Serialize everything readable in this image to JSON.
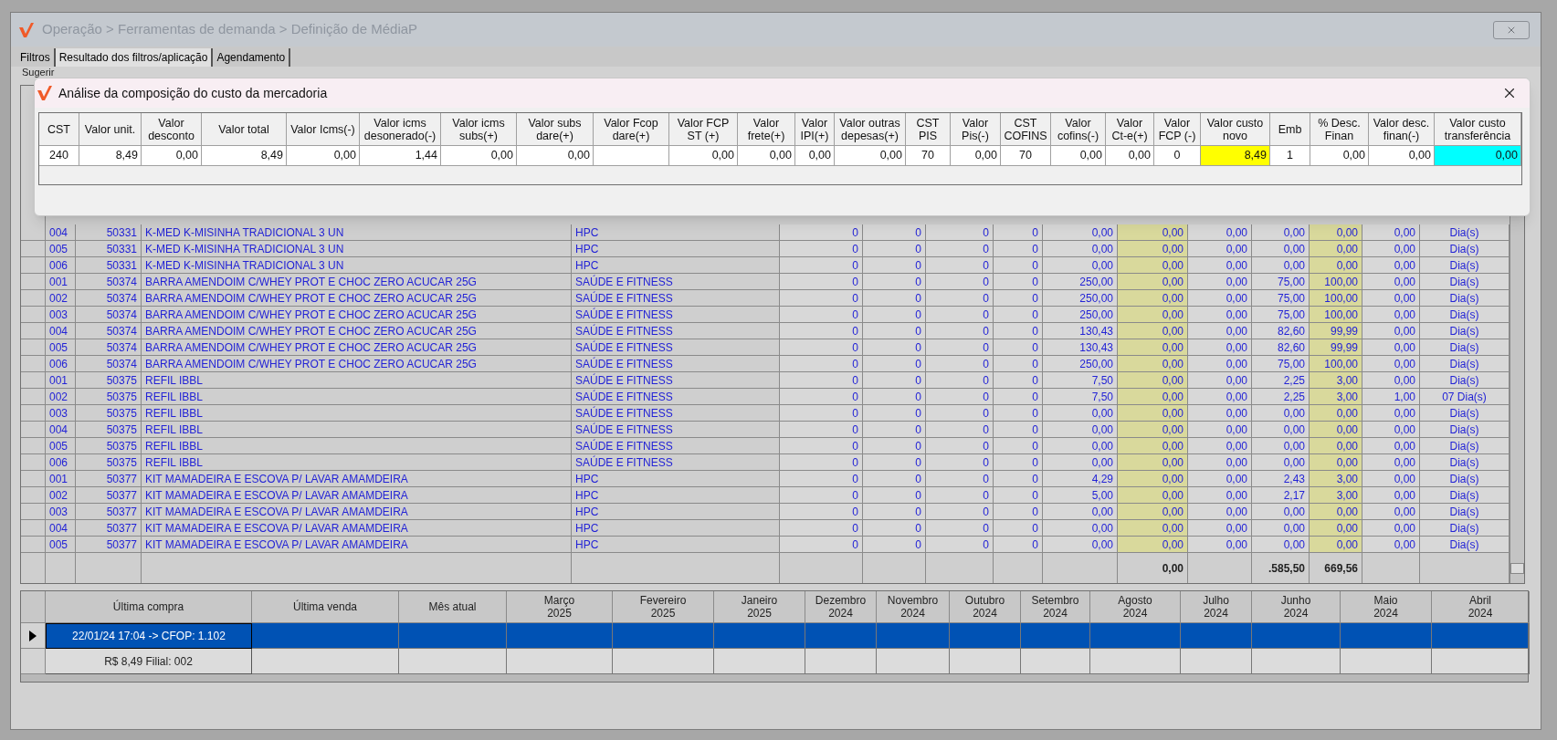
{
  "window": {
    "title": "Operação > Ferramentas de demanda > Definição de MédiaP"
  },
  "tabs": [
    {
      "label": "Filtros",
      "selected": false
    },
    {
      "label": "Resultado dos filtros/aplicação",
      "selected": true
    },
    {
      "label": "Agendamento",
      "selected": false
    }
  ],
  "group_label": "Sugerir",
  "grid": {
    "columns": [
      {
        "highlight": false
      },
      {
        "highlight": false
      },
      {
        "highlight": false
      },
      {
        "highlight": false
      },
      {
        "highlight": false
      },
      {
        "highlight": true
      },
      {
        "highlight": false
      },
      {
        "highlight": false
      },
      {
        "highlight": true
      },
      {
        "highlight": false
      },
      {
        "highlight": false
      }
    ],
    "rows": [
      {
        "branch": "004",
        "code": "50331",
        "description": "K-MED K-MISINHA TRADICIONAL 3 UN",
        "category": "HPC",
        "values": [
          "0",
          "0",
          "0",
          "0",
          "0,00",
          "0,00",
          "0,00",
          "0,00",
          "0,00",
          "0,00",
          "Dia(s)"
        ]
      },
      {
        "branch": "005",
        "code": "50331",
        "description": "K-MED K-MISINHA TRADICIONAL 3 UN",
        "category": "HPC",
        "values": [
          "0",
          "0",
          "0",
          "0",
          "0,00",
          "0,00",
          "0,00",
          "0,00",
          "0,00",
          "0,00",
          "Dia(s)"
        ]
      },
      {
        "branch": "006",
        "code": "50331",
        "description": "K-MED K-MISINHA TRADICIONAL 3 UN",
        "category": "HPC",
        "values": [
          "0",
          "0",
          "0",
          "0",
          "0,00",
          "0,00",
          "0,00",
          "0,00",
          "0,00",
          "0,00",
          "Dia(s)"
        ]
      },
      {
        "branch": "001",
        "code": "50374",
        "description": "BARRA AMENDOIM C/WHEY PROT E CHOC ZERO ACUCAR 25G",
        "category": "SAÚDE E FITNESS",
        "values": [
          "0",
          "0",
          "0",
          "0",
          "250,00",
          "0,00",
          "0,00",
          "75,00",
          "100,00",
          "0,00",
          "Dia(s)"
        ]
      },
      {
        "branch": "002",
        "code": "50374",
        "description": "BARRA AMENDOIM C/WHEY PROT E CHOC ZERO ACUCAR 25G",
        "category": "SAÚDE E FITNESS",
        "values": [
          "0",
          "0",
          "0",
          "0",
          "250,00",
          "0,00",
          "0,00",
          "75,00",
          "100,00",
          "0,00",
          "Dia(s)"
        ]
      },
      {
        "branch": "003",
        "code": "50374",
        "description": "BARRA AMENDOIM C/WHEY PROT E CHOC ZERO ACUCAR 25G",
        "category": "SAÚDE E FITNESS",
        "values": [
          "0",
          "0",
          "0",
          "0",
          "250,00",
          "0,00",
          "0,00",
          "75,00",
          "100,00",
          "0,00",
          "Dia(s)"
        ]
      },
      {
        "branch": "004",
        "code": "50374",
        "description": "BARRA AMENDOIM C/WHEY PROT E CHOC ZERO ACUCAR 25G",
        "category": "SAÚDE E FITNESS",
        "values": [
          "0",
          "0",
          "0",
          "0",
          "130,43",
          "0,00",
          "0,00",
          "82,60",
          "99,99",
          "0,00",
          "Dia(s)"
        ]
      },
      {
        "branch": "005",
        "code": "50374",
        "description": "BARRA AMENDOIM C/WHEY PROT E CHOC ZERO ACUCAR 25G",
        "category": "SAÚDE E FITNESS",
        "values": [
          "0",
          "0",
          "0",
          "0",
          "130,43",
          "0,00",
          "0,00",
          "82,60",
          "99,99",
          "0,00",
          "Dia(s)"
        ]
      },
      {
        "branch": "006",
        "code": "50374",
        "description": "BARRA AMENDOIM C/WHEY PROT E CHOC ZERO ACUCAR 25G",
        "category": "SAÚDE E FITNESS",
        "values": [
          "0",
          "0",
          "0",
          "0",
          "250,00",
          "0,00",
          "0,00",
          "75,00",
          "100,00",
          "0,00",
          "Dia(s)"
        ]
      },
      {
        "branch": "001",
        "code": "50375",
        "description": "REFIL IBBL",
        "category": "SAÚDE E FITNESS",
        "values": [
          "0",
          "0",
          "0",
          "0",
          "7,50",
          "0,00",
          "0,00",
          "2,25",
          "3,00",
          "0,00",
          "Dia(s)"
        ]
      },
      {
        "branch": "002",
        "code": "50375",
        "description": "REFIL IBBL",
        "category": "SAÚDE E FITNESS",
        "values": [
          "0",
          "0",
          "0",
          "0",
          "7,50",
          "0,00",
          "0,00",
          "2,25",
          "3,00",
          "1,00",
          "07 Dia(s)"
        ]
      },
      {
        "branch": "003",
        "code": "50375",
        "description": "REFIL IBBL",
        "category": "SAÚDE E FITNESS",
        "values": [
          "0",
          "0",
          "0",
          "0",
          "0,00",
          "0,00",
          "0,00",
          "0,00",
          "0,00",
          "0,00",
          "Dia(s)"
        ]
      },
      {
        "branch": "004",
        "code": "50375",
        "description": "REFIL IBBL",
        "category": "SAÚDE E FITNESS",
        "values": [
          "0",
          "0",
          "0",
          "0",
          "0,00",
          "0,00",
          "0,00",
          "0,00",
          "0,00",
          "0,00",
          "Dia(s)"
        ]
      },
      {
        "branch": "005",
        "code": "50375",
        "description": "REFIL IBBL",
        "category": "SAÚDE E FITNESS",
        "values": [
          "0",
          "0",
          "0",
          "0",
          "0,00",
          "0,00",
          "0,00",
          "0,00",
          "0,00",
          "0,00",
          "Dia(s)"
        ]
      },
      {
        "branch": "006",
        "code": "50375",
        "description": "REFIL IBBL",
        "category": "SAÚDE E FITNESS",
        "values": [
          "0",
          "0",
          "0",
          "0",
          "0,00",
          "0,00",
          "0,00",
          "0,00",
          "0,00",
          "0,00",
          "Dia(s)"
        ]
      },
      {
        "branch": "001",
        "code": "50377",
        "description": "KIT MAMADEIRA E ESCOVA P/ LAVAR AMAMDEIRA",
        "category": "HPC",
        "values": [
          "0",
          "0",
          "0",
          "0",
          "4,29",
          "0,00",
          "0,00",
          "2,43",
          "3,00",
          "0,00",
          "Dia(s)"
        ]
      },
      {
        "branch": "002",
        "code": "50377",
        "description": "KIT MAMADEIRA E ESCOVA P/ LAVAR AMAMDEIRA",
        "category": "HPC",
        "values": [
          "0",
          "0",
          "0",
          "0",
          "5,00",
          "0,00",
          "0,00",
          "2,17",
          "3,00",
          "0,00",
          "Dia(s)"
        ]
      },
      {
        "branch": "003",
        "code": "50377",
        "description": "KIT MAMADEIRA E ESCOVA P/ LAVAR AMAMDEIRA",
        "category": "HPC",
        "values": [
          "0",
          "0",
          "0",
          "0",
          "0,00",
          "0,00",
          "0,00",
          "0,00",
          "0,00",
          "0,00",
          "Dia(s)"
        ]
      },
      {
        "branch": "004",
        "code": "50377",
        "description": "KIT MAMADEIRA E ESCOVA P/ LAVAR AMAMDEIRA",
        "category": "HPC",
        "values": [
          "0",
          "0",
          "0",
          "0",
          "0,00",
          "0,00",
          "0,00",
          "0,00",
          "0,00",
          "0,00",
          "Dia(s)"
        ]
      },
      {
        "branch": "005",
        "code": "50377",
        "description": "KIT MAMADEIRA E ESCOVA P/ LAVAR AMAMDEIRA",
        "category": "HPC",
        "values": [
          "0",
          "0",
          "0",
          "0",
          "0,00",
          "0,00",
          "0,00",
          "0,00",
          "0,00",
          "0,00",
          "Dia(s)"
        ]
      }
    ],
    "totals": {
      "column_6": "0,00",
      "column_8": ".585,50",
      "column_9": "669,56"
    }
  },
  "history": {
    "columns": [
      "Última compra",
      "Última venda",
      "Mês atual",
      "Março\n2025",
      "Fevereiro\n2025",
      "Janeiro\n2025",
      "Dezembro\n2024",
      "Novembro\n2024",
      "Outubro\n2024",
      "Setembro\n2024",
      "Agosto\n2024",
      "Julho\n2024",
      "Junho\n2024",
      "Maio\n2024",
      "Abril\n2024"
    ],
    "rows": [
      {
        "selected": true,
        "cells": [
          "22/01/24 17:04 -> CFOP: 1.102"
        ]
      },
      {
        "selected": false,
        "cells": [
          "R$ 8,49 Filial: 002"
        ]
      }
    ]
  },
  "dialog": {
    "title": "Análise da composição do custo da mercadoria",
    "columns": [
      {
        "label": "CST",
        "value": "240",
        "kind": "code"
      },
      {
        "label": "Valor unit.",
        "value": "8,49",
        "kind": "amount"
      },
      {
        "label": "Valor\ndesconto",
        "value": "0,00",
        "kind": "amount"
      },
      {
        "label": "Valor total",
        "value": "8,49",
        "kind": "amount"
      },
      {
        "label": "Valor Icms(-)",
        "value": "0,00",
        "kind": "amount"
      },
      {
        "label": "Valor icms\ndesonerado(-)",
        "value": "1,44",
        "kind": "amount"
      },
      {
        "label": "Valor icms\nsubs(+)",
        "value": "0,00",
        "kind": "amount"
      },
      {
        "label": "Valor subs\ndare(+)",
        "value": "0,00",
        "kind": "amount"
      },
      {
        "label": "Valor Fcop\ndare(+)",
        "kind": "amount"
      },
      {
        "label": "Valor FCP\nST (+)",
        "value": "0,00",
        "kind": "amount"
      },
      {
        "label": "Valor\nfrete(+)",
        "value": "0,00",
        "kind": "amount"
      },
      {
        "label": "Valor\nIPI(+)",
        "value": "0,00",
        "kind": "amount"
      },
      {
        "label": "Valor outras\ndepesas(+)",
        "value": "0,00",
        "kind": "amount"
      },
      {
        "label": "CST\nPIS",
        "value": "70",
        "kind": "code"
      },
      {
        "label": "Valor\nPis(-)",
        "value": "0,00",
        "kind": "amount"
      },
      {
        "label": "CST\nCOFINS",
        "value": "70",
        "kind": "code"
      },
      {
        "label": "Valor\ncofins(-)",
        "value": "0,00",
        "kind": "amount"
      },
      {
        "label": "Valor\nCt-e(+)",
        "value": "0,00",
        "kind": "amount"
      },
      {
        "label": "Valor\nFCP (-)",
        "value": "0",
        "kind": "code"
      },
      {
        "label": "Valor custo\nnovo",
        "value": "8,49",
        "kind": "amount",
        "color": "#ffff00"
      },
      {
        "label": "Emb",
        "value": "1",
        "kind": "code"
      },
      {
        "label": "% Desc.\nFinan",
        "value": "0,00",
        "kind": "amount"
      },
      {
        "label": "Valor desc.\nfinan(-)",
        "value": "0,00",
        "kind": "amount"
      },
      {
        "label": "Valor custo\ntransferência",
        "value": "0,00",
        "kind": "amount",
        "color": "#00ffff"
      }
    ]
  }
}
